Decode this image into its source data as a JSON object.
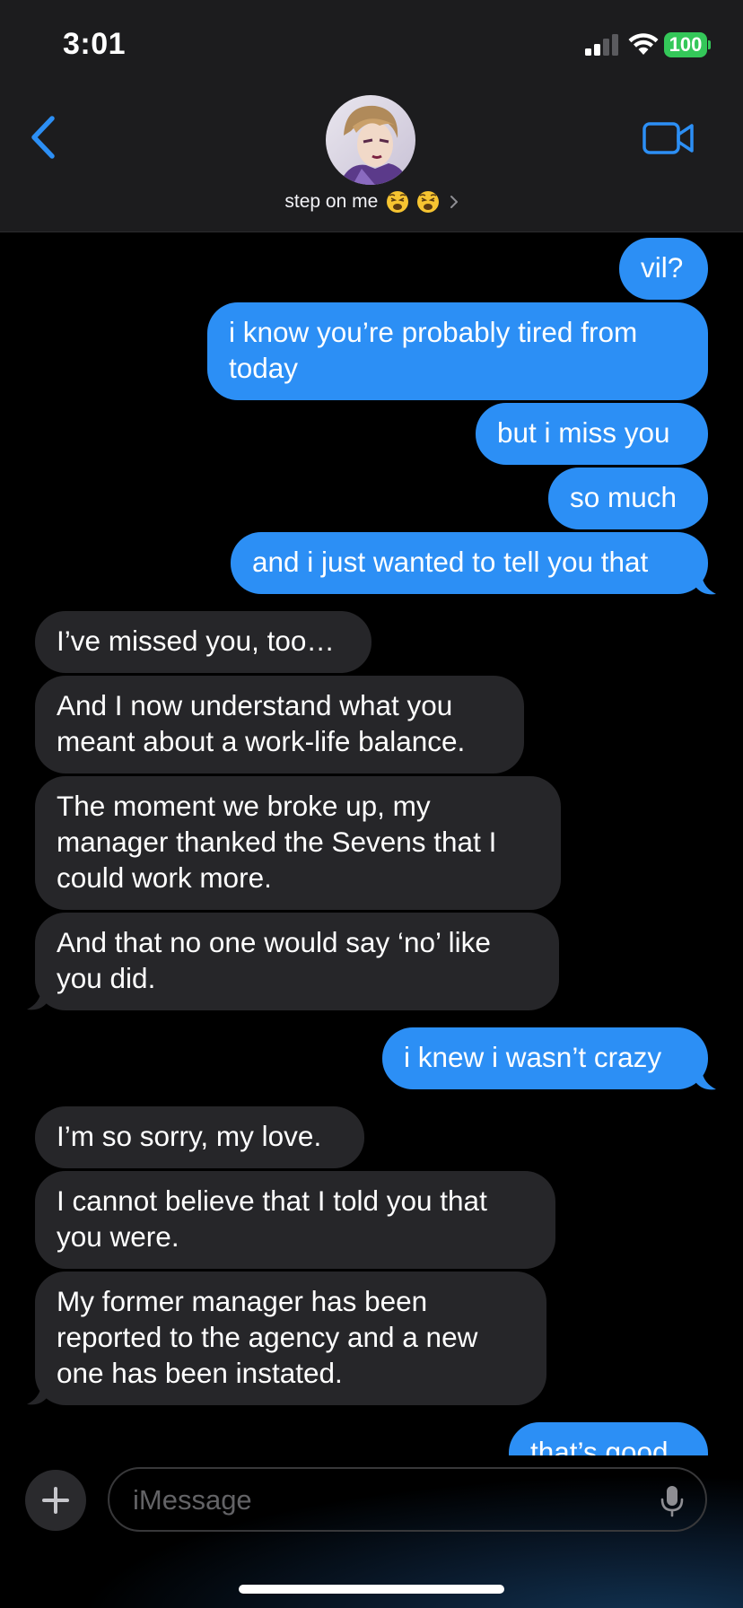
{
  "status_bar": {
    "time": "3:01",
    "battery": "100",
    "battery_color": "#34c759"
  },
  "header": {
    "back_icon": "chevron-left-icon",
    "contact_name": "step on me",
    "contact_emojis": [
      "weary-face-emoji",
      "weary-face-emoji"
    ],
    "video_icon": "video-camera-icon",
    "accent_color": "#2c8ff5"
  },
  "messages": [
    {
      "from": "me",
      "text": "vil?"
    },
    {
      "from": "me",
      "text": "i know you’re probably tired from\ntoday"
    },
    {
      "from": "me",
      "text": "but i miss you"
    },
    {
      "from": "me",
      "text": "so much"
    },
    {
      "from": "me",
      "text": "and i just wanted to tell you that"
    },
    {
      "from": "them",
      "text": "I’ve missed you, too…"
    },
    {
      "from": "them",
      "text": "And I now understand what you\nmeant about a work-life balance."
    },
    {
      "from": "them",
      "text": "The moment we broke up, my\nmanager thanked the Sevens that I\ncould work more."
    },
    {
      "from": "them",
      "text": "And that no one would say ‘no’ like\nyou did."
    },
    {
      "from": "me",
      "text": "i knew i wasn’t crazy"
    },
    {
      "from": "them",
      "text": "I’m so sorry, my love."
    },
    {
      "from": "them",
      "text": "I cannot believe that I told you that\nyou were."
    },
    {
      "from": "them",
      "text": "My former manager has been\nreported to the agency and a new\none has been instated."
    },
    {
      "from": "me",
      "text": "that’s good"
    }
  ],
  "compose": {
    "placeholder": "iMessage",
    "value": "",
    "plus_icon": "plus-icon",
    "mic_icon": "microphone-icon"
  },
  "colors": {
    "sent_bubble": "#2c8ff5",
    "received_bubble": "#262629",
    "background": "#000000",
    "header_background": "#1c1c1e"
  }
}
